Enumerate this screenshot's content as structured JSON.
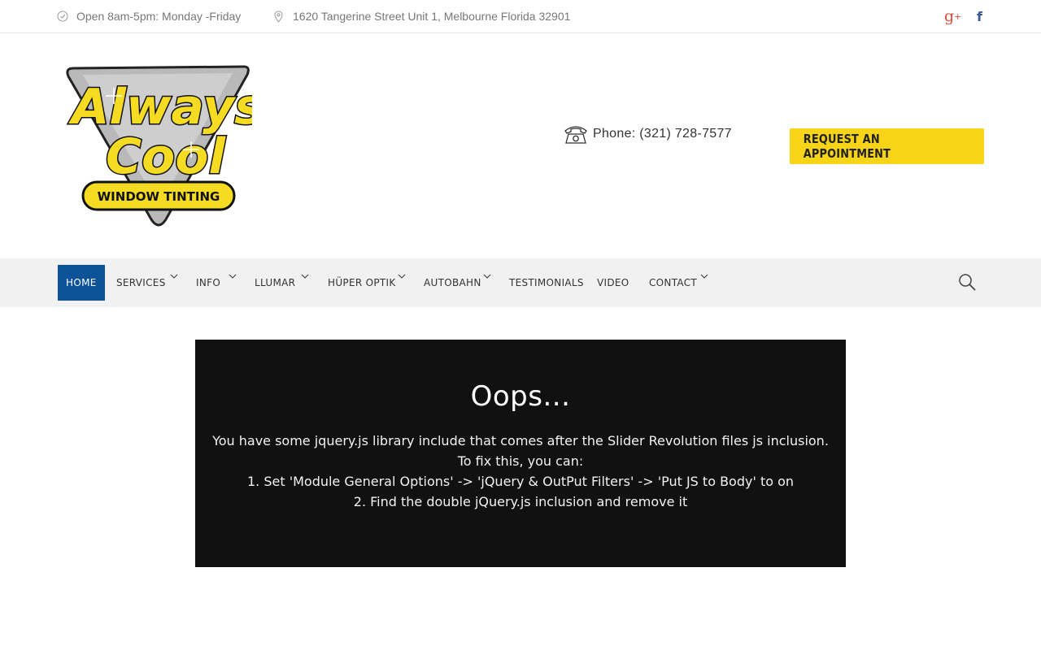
{
  "topbar": {
    "hours": "Open 8am-5pm: Monday -Friday",
    "address": "1620 Tangerine Street Unit 1, Melbourne Florida 32901",
    "social": {
      "gplus_label": "g",
      "gplus_sup": "+",
      "facebook_label": "f"
    }
  },
  "header": {
    "logo_text": {
      "line1": "Always",
      "line2": "Cool",
      "line3": "WINDOW TINTING"
    },
    "phone": "Phone: (321) 728-7577",
    "cta_label": "REQUEST AN APPOINTMENT"
  },
  "nav": {
    "items": [
      {
        "label": "HOME",
        "active": true,
        "dropdown": false
      },
      {
        "label": "SERVICES",
        "dropdown": true
      },
      {
        "label": "INFO",
        "dropdown": true
      },
      {
        "label": "LLUMAR",
        "dropdown": true
      },
      {
        "label": "HÜPER OPTIK",
        "dropdown": true
      },
      {
        "label": "AUTOBAHN",
        "dropdown": true
      },
      {
        "label": "TESTIMONIALS",
        "dropdown": false
      },
      {
        "label": "VIDEO",
        "dropdown": false
      },
      {
        "label": "CONTACT",
        "dropdown": true
      }
    ]
  },
  "error": {
    "title": "Oops...",
    "lines": [
      "You have some jquery.js library include that comes after the Slider Revolution files js inclusion.",
      "To fix this, you can:",
      "1. Set 'Module General Options' -> 'jQuery & OutPut Filters' -> 'Put JS to Body' to on",
      "2. Find the double jQuery.js inclusion and remove it"
    ]
  },
  "colors": {
    "accent_yellow": "#f7d417",
    "nav_active": "#0d5297",
    "nav_bg": "#f1f1f1",
    "error_bg": "#111111"
  }
}
